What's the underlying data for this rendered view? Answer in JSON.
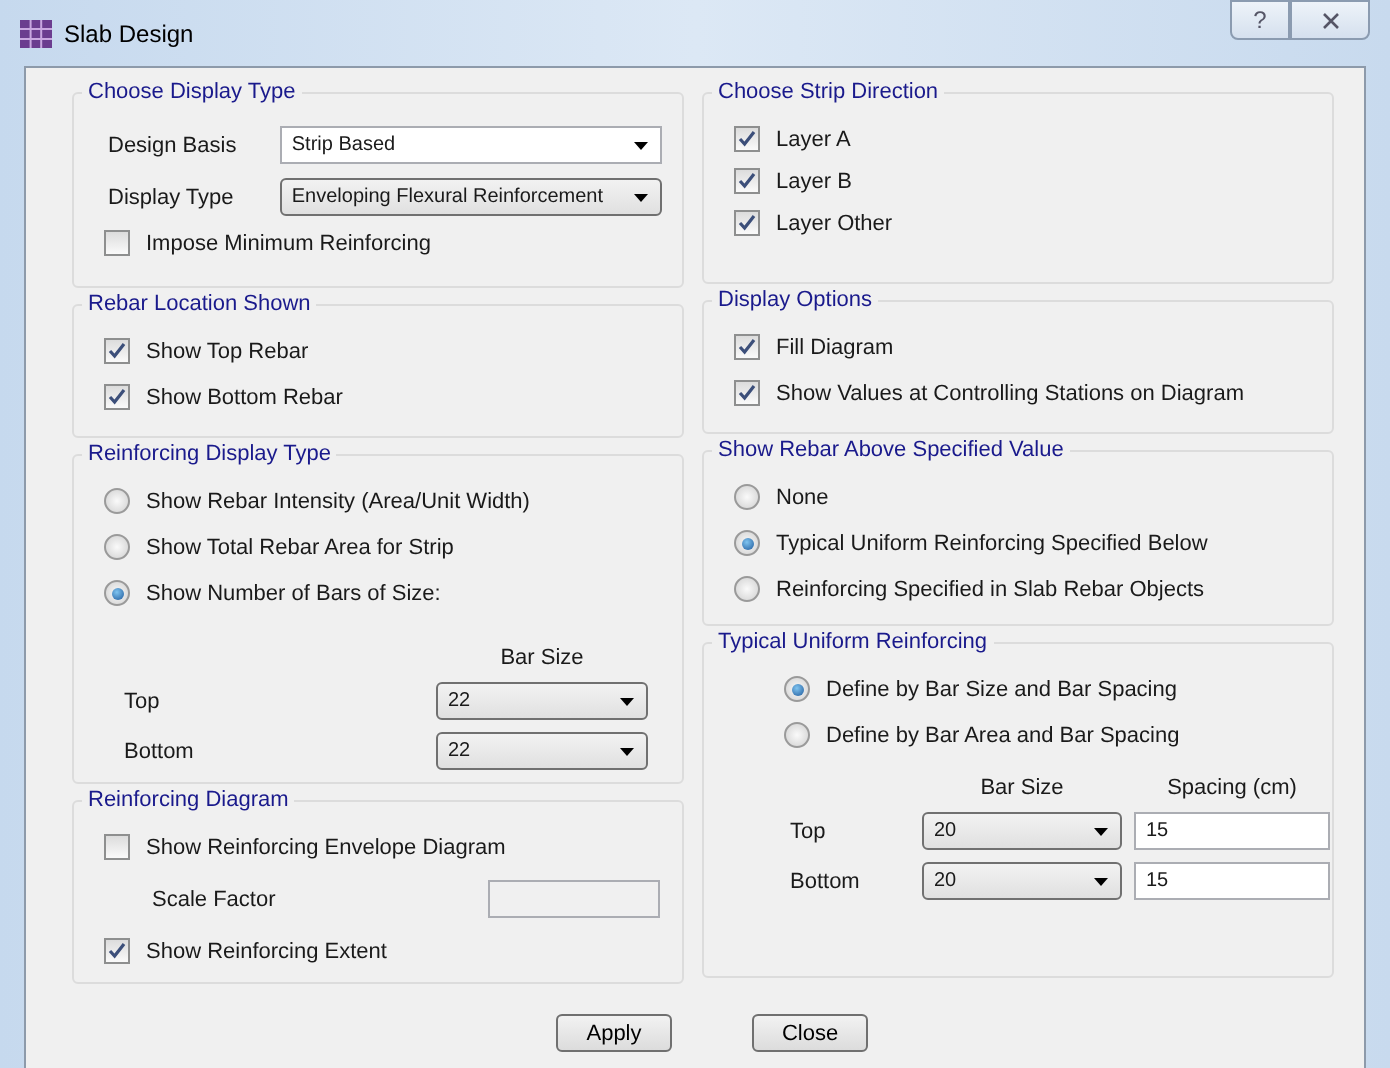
{
  "window": {
    "title": "Slab Design",
    "help_button": "?"
  },
  "left_groups": [
    {
      "title": "Choose Display Type",
      "items": [
        {
          "kind": "dropdown",
          "label": "Design Basis",
          "value": "Strip Based"
        },
        {
          "kind": "dropdown",
          "label": "Display Type",
          "value": "Enveloping Flexural Reinforcement"
        },
        {
          "kind": "checkbox",
          "label": "Impose Minimum Reinforcing",
          "checked": false
        }
      ]
    },
    {
      "title": "Rebar Location Shown",
      "items": [
        {
          "kind": "checkbox",
          "label": "Show Top Rebar",
          "checked": true
        },
        {
          "kind": "checkbox",
          "label": "Show Bottom Rebar",
          "checked": true
        }
      ]
    },
    {
      "title": "Reinforcing Display Type",
      "items": [
        {
          "kind": "radio",
          "label": "Show Rebar Intensity (Area/Unit Width)",
          "selected": false
        },
        {
          "kind": "radio",
          "label": "Show Total Rebar Area for Strip",
          "selected": false
        },
        {
          "kind": "radio",
          "label": "Show Number of Bars of Size:",
          "selected": true
        },
        {
          "kind": "bar_table",
          "headers": [
            "Bar Size"
          ],
          "rows": [
            {
              "label": "Top",
              "bar_size": "22"
            },
            {
              "label": "Bottom",
              "bar_size": "22"
            }
          ]
        }
      ]
    },
    {
      "title": "Reinforcing Diagram",
      "items": [
        {
          "kind": "checkbox",
          "label": "Show Reinforcing Envelope Diagram",
          "checked": false
        },
        {
          "kind": "field",
          "label": "Scale Factor"
        },
        {
          "kind": "checkbox",
          "label": "Show Reinforcing Extent",
          "checked": true
        }
      ]
    }
  ],
  "right_groups": [
    {
      "title": "Choose Strip Direction",
      "items": [
        {
          "kind": "checkbox",
          "label": "Layer A",
          "checked": true
        },
        {
          "kind": "checkbox",
          "label": "Layer B",
          "checked": true
        },
        {
          "kind": "checkbox",
          "label": "Layer Other",
          "checked": true
        }
      ]
    },
    {
      "title": "Display Options",
      "items": [
        {
          "kind": "checkbox",
          "label": "Fill Diagram",
          "checked": true
        },
        {
          "kind": "checkbox",
          "label": "Show Values at Controlling Stations on Diagram",
          "checked": true
        }
      ]
    },
    {
      "title": "Show Rebar Above Specified Value",
      "items": [
        {
          "kind": "radio",
          "label": "None",
          "selected": false
        },
        {
          "kind": "radio",
          "label": "Typical Uniform Reinforcing Specified Below",
          "selected": true
        },
        {
          "kind": "radio",
          "label": "Reinforcing Specified in Slab Rebar Objects",
          "selected": false
        }
      ]
    },
    {
      "title": "Typical Uniform Reinforcing",
      "items": [
        {
          "kind": "radio",
          "label": "Define by Bar Size and Bar Spacing",
          "selected": true
        },
        {
          "kind": "radio",
          "label": "Define by Bar Area and Bar Spacing",
          "selected": false
        },
        {
          "kind": "bar_table",
          "headers": [
            "Bar Size",
            "Spacing  (cm)"
          ],
          "rows": [
            {
              "label": "Top",
              "bar_size": "20",
              "spacing": "15"
            },
            {
              "label": "Bottom",
              "bar_size": "20",
              "spacing": "15"
            }
          ]
        }
      ]
    }
  ],
  "buttons": [
    "Apply",
    "Close"
  ]
}
